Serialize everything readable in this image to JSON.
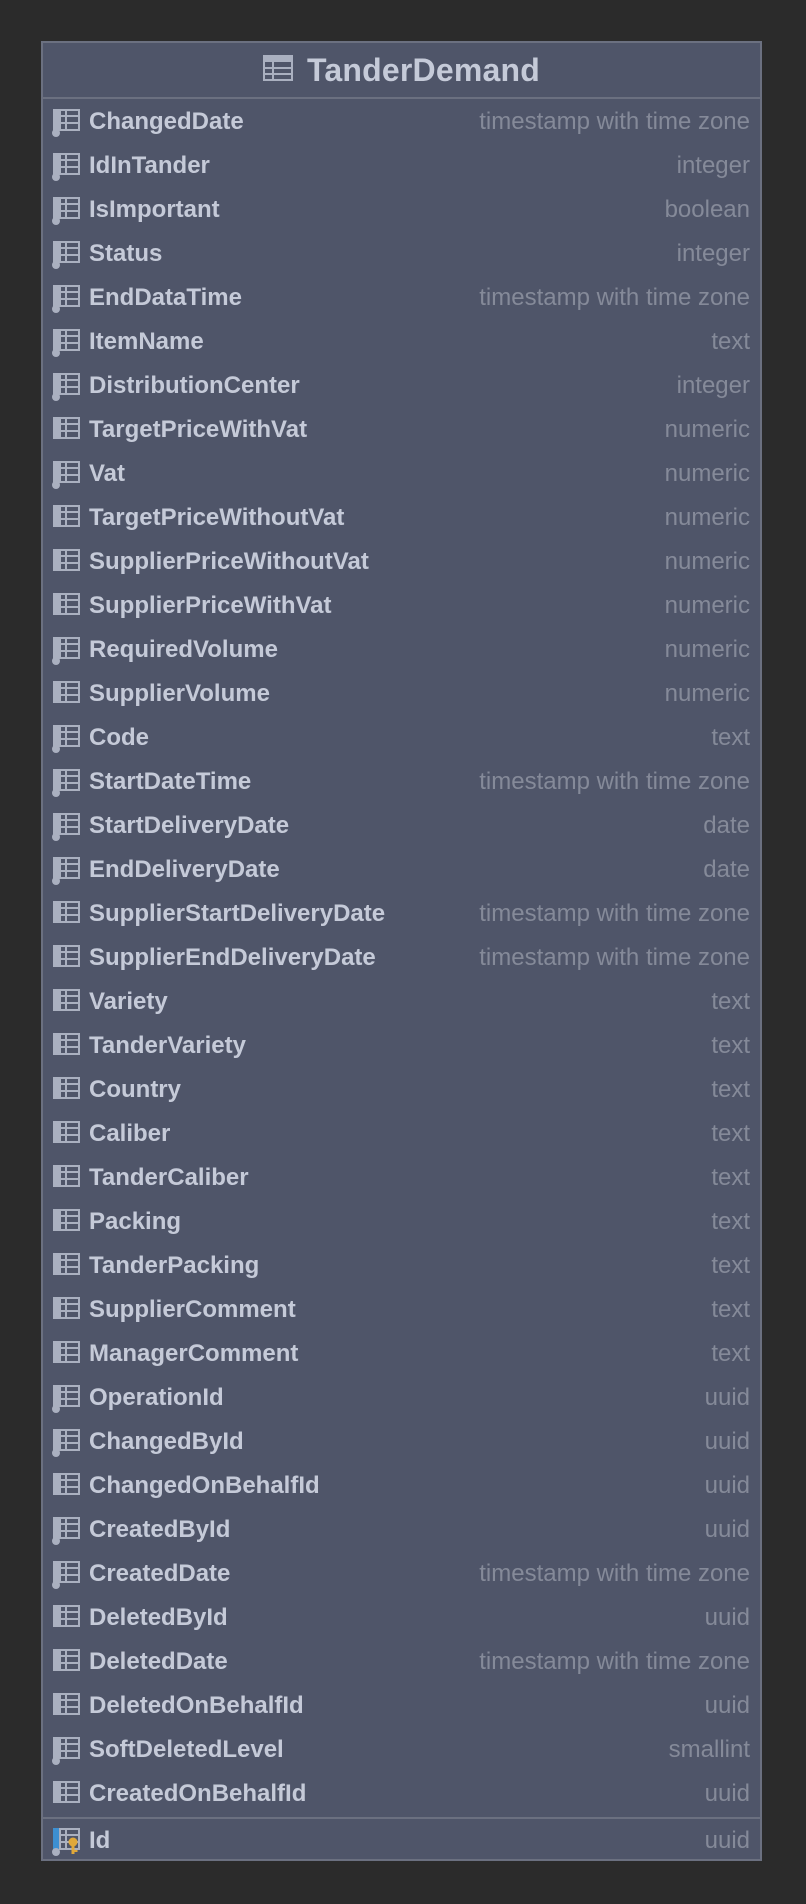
{
  "table": {
    "title": "TanderDemand",
    "columns": [
      {
        "name": "ChangedDate",
        "type": "timestamp with time zone",
        "notnull": true
      },
      {
        "name": "IdInTander",
        "type": "integer",
        "notnull": true
      },
      {
        "name": "IsImportant",
        "type": "boolean",
        "notnull": true
      },
      {
        "name": "Status",
        "type": "integer",
        "notnull": true
      },
      {
        "name": "EndDataTime",
        "type": "timestamp with time zone",
        "notnull": true
      },
      {
        "name": "ItemName",
        "type": "text",
        "notnull": true
      },
      {
        "name": "DistributionCenter",
        "type": "integer",
        "notnull": true
      },
      {
        "name": "TargetPriceWithVat",
        "type": "numeric",
        "notnull": false
      },
      {
        "name": "Vat",
        "type": "numeric",
        "notnull": true
      },
      {
        "name": "TargetPriceWithoutVat",
        "type": "numeric",
        "notnull": false
      },
      {
        "name": "SupplierPriceWithoutVat",
        "type": "numeric",
        "notnull": false
      },
      {
        "name": "SupplierPriceWithVat",
        "type": "numeric",
        "notnull": false
      },
      {
        "name": "RequiredVolume",
        "type": "numeric",
        "notnull": true
      },
      {
        "name": "SupplierVolume",
        "type": "numeric",
        "notnull": false
      },
      {
        "name": "Code",
        "type": "text",
        "notnull": true
      },
      {
        "name": "StartDateTime",
        "type": "timestamp with time zone",
        "notnull": true
      },
      {
        "name": "StartDeliveryDate",
        "type": "date",
        "notnull": true
      },
      {
        "name": "EndDeliveryDate",
        "type": "date",
        "notnull": true
      },
      {
        "name": "SupplierStartDeliveryDate",
        "type": "timestamp with time zone",
        "notnull": false
      },
      {
        "name": "SupplierEndDeliveryDate",
        "type": "timestamp with time zone",
        "notnull": false
      },
      {
        "name": "Variety",
        "type": "text",
        "notnull": false
      },
      {
        "name": "TanderVariety",
        "type": "text",
        "notnull": false
      },
      {
        "name": "Country",
        "type": "text",
        "notnull": false
      },
      {
        "name": "Caliber",
        "type": "text",
        "notnull": false
      },
      {
        "name": "TanderCaliber",
        "type": "text",
        "notnull": false
      },
      {
        "name": "Packing",
        "type": "text",
        "notnull": false
      },
      {
        "name": "TanderPacking",
        "type": "text",
        "notnull": false
      },
      {
        "name": "SupplierComment",
        "type": "text",
        "notnull": false
      },
      {
        "name": "ManagerComment",
        "type": "text",
        "notnull": false
      },
      {
        "name": "OperationId",
        "type": "uuid",
        "notnull": true
      },
      {
        "name": "ChangedById",
        "type": "uuid",
        "notnull": true
      },
      {
        "name": "ChangedOnBehalfId",
        "type": "uuid",
        "notnull": false
      },
      {
        "name": "CreatedById",
        "type": "uuid",
        "notnull": true
      },
      {
        "name": "CreatedDate",
        "type": "timestamp with time zone",
        "notnull": true
      },
      {
        "name": "DeletedById",
        "type": "uuid",
        "notnull": false
      },
      {
        "name": "DeletedDate",
        "type": "timestamp with time zone",
        "notnull": false
      },
      {
        "name": "DeletedOnBehalfId",
        "type": "uuid",
        "notnull": false
      },
      {
        "name": "SoftDeletedLevel",
        "type": "smallint",
        "notnull": true
      },
      {
        "name": "CreatedOnBehalfId",
        "type": "uuid",
        "notnull": false
      }
    ],
    "primary_key": {
      "name": "Id",
      "type": "uuid",
      "notnull": true
    }
  },
  "icons": {
    "table": "table-icon",
    "column": "column-icon",
    "not_null_marker": "not-null-dot-icon",
    "primary_key": "primary-key-icon"
  },
  "colors": {
    "background": "#2b2b2b",
    "table_fill": "#4f5569",
    "border": "#6b7080",
    "name_text": "#c5cad8",
    "type_text": "#858a99",
    "icon": "#aab0c0",
    "key_gold": "#e0a83a",
    "key_blue": "#3d8fd1"
  }
}
